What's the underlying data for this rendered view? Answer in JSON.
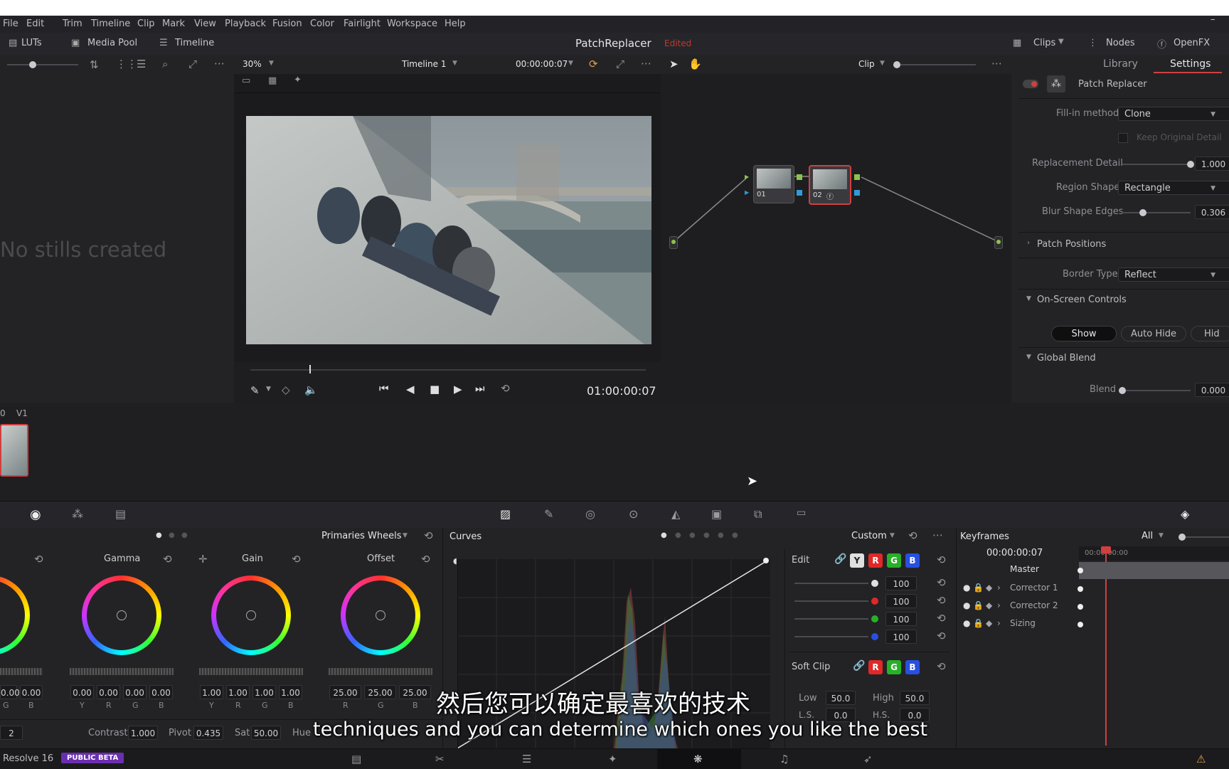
{
  "menu": [
    "File",
    "Edit",
    "Trim",
    "Timeline",
    "Clip",
    "Mark",
    "View",
    "Playback",
    "Fusion",
    "Color",
    "Fairlight",
    "Workspace",
    "Help"
  ],
  "toolbar": {
    "luts": "LUTs",
    "media_pool": "Media Pool",
    "timeline": "Timeline",
    "project_name": "PatchReplacer",
    "project_status": "Edited",
    "clips": "Clips",
    "nodes": "Nodes",
    "openfx": "OpenFX"
  },
  "viewer": {
    "zoom": "30%",
    "timeline_name": "Timeline 1",
    "timecode_top": "00:00:00:07",
    "timecode_bottom": "01:00:00:07",
    "playhead_fraction": 0.15
  },
  "gallery": {
    "empty_text": "No stills created"
  },
  "node_editor": {
    "mode": "Clip",
    "nodes": [
      {
        "label": "01"
      },
      {
        "label": "02"
      }
    ]
  },
  "settings_panel": {
    "tabs": [
      "Library",
      "Settings"
    ],
    "active_tab": "Settings",
    "effect_name": "Patch Replacer",
    "fill_in_method_label": "Fill-in method",
    "fill_in_method_value": "Clone",
    "keep_original_detail": "Keep Original Detail",
    "replacement_detail_label": "Replacement Detail",
    "replacement_detail_value": "1.000",
    "region_shape_label": "Region Shape",
    "region_shape_value": "Rectangle",
    "blur_shape_edges_label": "Blur Shape Edges",
    "blur_shape_edges_value": "0.306",
    "patch_positions": "Patch Positions",
    "border_type_label": "Border Type",
    "border_type_value": "Reflect",
    "on_screen_controls": "On-Screen Controls",
    "osc_buttons": [
      "Show",
      "Auto Hide",
      "Hid"
    ],
    "global_blend": "Global Blend",
    "blend_label": "Blend",
    "blend_value": "0.000"
  },
  "clip_strip": {
    "track_num": "0",
    "track_label": "V1"
  },
  "primaries": {
    "mode": "Primaries Wheels",
    "wheels": [
      {
        "name": "Gamma",
        "values": [
          "0.00",
          "0.00",
          "0.00",
          "0.00"
        ]
      },
      {
        "name": "Gain",
        "values": [
          "1.00",
          "1.00",
          "1.00",
          "1.00"
        ]
      },
      {
        "name": "Offset",
        "values": [
          "25.00",
          "25.00",
          "25.00"
        ]
      }
    ],
    "lift_values": [
      "0.00",
      "0.00"
    ],
    "lift_channels": [
      "G",
      "B"
    ],
    "channels4": [
      "Y",
      "R",
      "G",
      "B"
    ],
    "channels3": [
      "R",
      "G",
      "B"
    ],
    "page_num": "2",
    "contrast_label": "Contrast",
    "contrast_value": "1.000",
    "pivot_label": "Pivot",
    "pivot_value": "0.435",
    "sat_label": "Sat",
    "sat_value": "50.00",
    "hue_label": "Hue"
  },
  "curves": {
    "title": "Curves",
    "mode": "Custom",
    "edit_label": "Edit",
    "channel_chips": [
      "Y",
      "R",
      "G",
      "B"
    ],
    "intensities": [
      "100",
      "100",
      "100",
      "100"
    ],
    "soft_clip": "Soft Clip",
    "soft_chips": [
      "R",
      "G",
      "B"
    ],
    "low_label": "Low",
    "low_value": "50.0",
    "high_label": "High",
    "high_value": "50.0",
    "ls_label": "L.S.",
    "ls_value": "0.0",
    "hs_label": "H.S.",
    "hs_value": "0.0",
    "colors": {
      "y": "#e0e0e0",
      "r": "#e02828",
      "g": "#28b028",
      "b": "#2850e0"
    }
  },
  "keyframes": {
    "title": "Keyframes",
    "filter": "All",
    "timecode": "00:00:00:07",
    "ruler_start": "00:00:00:00",
    "tracks": [
      "Master",
      "Corrector 1",
      "Corrector 2",
      "Sizing"
    ]
  },
  "subtitles": {
    "chinese": "然后您可以确定最喜欢的技术",
    "english": "techniques and you can determine which ones you like the best"
  },
  "status": {
    "app": "Resolve 16",
    "badge": "PUBLIC BETA"
  }
}
